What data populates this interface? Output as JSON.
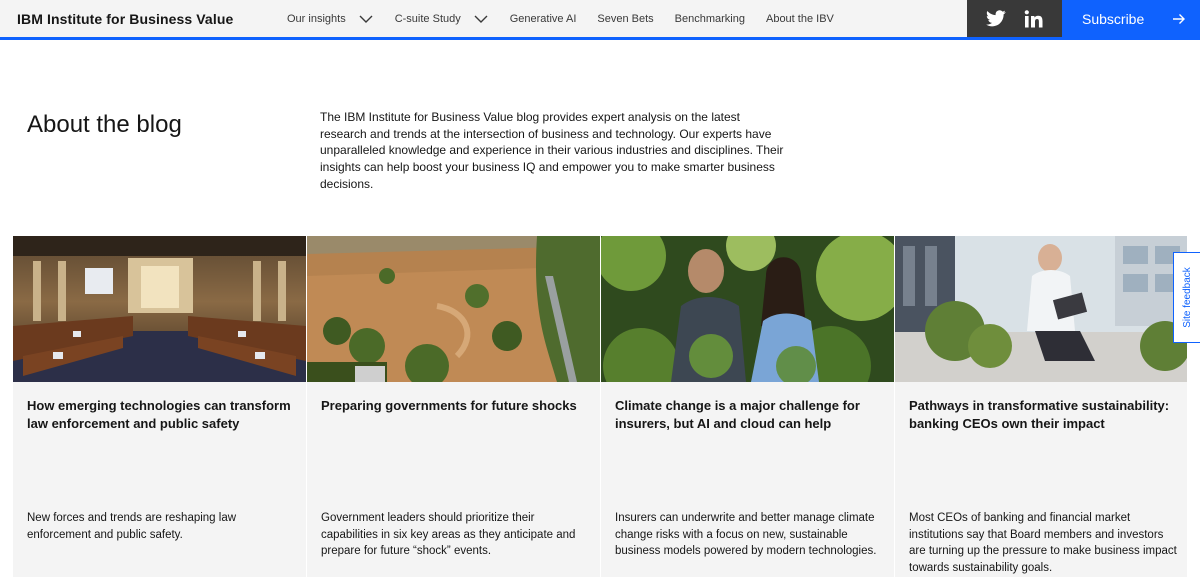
{
  "header": {
    "brand": "IBM Institute for Business Value",
    "nav": [
      {
        "label": "Our insights",
        "dropdown": true
      },
      {
        "label": "C-suite Study",
        "dropdown": true
      },
      {
        "label": "Generative AI",
        "dropdown": false
      },
      {
        "label": "Seven Bets",
        "dropdown": false
      },
      {
        "label": "Benchmarking",
        "dropdown": false
      },
      {
        "label": "About the IBV",
        "dropdown": false
      }
    ],
    "social": [
      "twitter-icon",
      "linkedin-icon"
    ],
    "subscribe_label": "Subscribe"
  },
  "intro": {
    "title": "About the blog",
    "text": "The IBM Institute for Business Value blog provides expert analysis on the latest research and trends at the intersection of business and technology. Our experts have unparalleled knowledge and experience in their various industries and disciplines. Their insights can help boost your business IQ and empower you to make smarter business decisions."
  },
  "cards": [
    {
      "image": "legislative-chamber-photo",
      "title": "How emerging technologies can transform law enforcement and public safety",
      "description": "New forces and trends are reshaping law enforcement and public safety."
    },
    {
      "image": "flooded-landscape-photo",
      "title": "Preparing governments for future shocks",
      "description": "Government leaders should prioritize their capabilities in six key areas as they anticipate and prepare for future “shock” events."
    },
    {
      "image": "people-in-foliage-photo",
      "title": "Climate change is a major challenge for insurers, but AI and cloud can help",
      "description": "Insurers can underwrite and better manage climate change risks with a focus on new, sustainable business models powered by modern technologies."
    },
    {
      "image": "man-with-laptop-outdoors-photo",
      "title": "Pathways in transformative sustainability: banking CEOs own their impact",
      "description": "Most CEOs of banking and financial market institutions say that Board members and investors are turning up the pressure to make business impact towards sustainability goals."
    }
  ],
  "feedback_label": "Site feedback",
  "colors": {
    "accent": "#0f62fe",
    "header_bg": "#f4f4f4",
    "social_bg": "#393939",
    "card_bg": "#f4f4f4"
  }
}
